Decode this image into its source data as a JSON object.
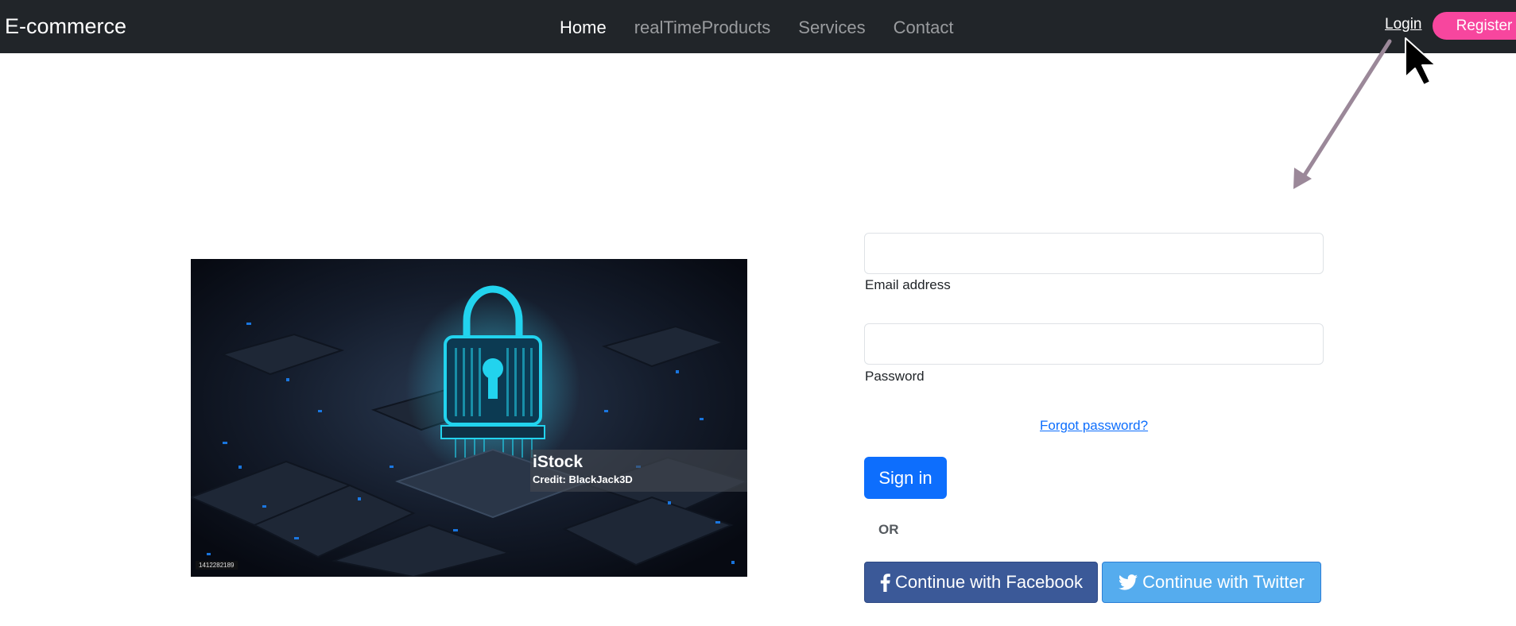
{
  "navbar": {
    "brand": "E-commerce",
    "links": [
      {
        "label": "Home",
        "active": true
      },
      {
        "label": "realTimeProducts",
        "active": false
      },
      {
        "label": "Services",
        "active": false
      },
      {
        "label": "Contact",
        "active": false
      }
    ],
    "login_label": "Login",
    "register_label": "Register"
  },
  "hero_image": {
    "watermark_brand": "iStock",
    "credit": "Credit: BlackJack3D",
    "image_id": "1412282189"
  },
  "form": {
    "email_label": "Email address",
    "email_value": "",
    "password_label": "Password",
    "password_value": "",
    "forgot_password": "Forgot password?",
    "sign_in": "Sign in",
    "or": "OR",
    "facebook": "Continue with Facebook",
    "twitter": "Continue with Twitter"
  },
  "icons": {
    "facebook": "facebook-icon",
    "twitter": "twitter-icon",
    "lock": "lock-icon",
    "cursor": "mouse-cursor-icon",
    "arrow": "annotation-arrow-icon"
  },
  "colors": {
    "navbar_bg": "#212529",
    "register_bg": "#f7469e",
    "primary": "#0d6efd",
    "facebook": "#3b5998",
    "twitter": "#55acee",
    "annotation_arrow": "#9b8899",
    "lock_glow": "#22d3ee"
  }
}
